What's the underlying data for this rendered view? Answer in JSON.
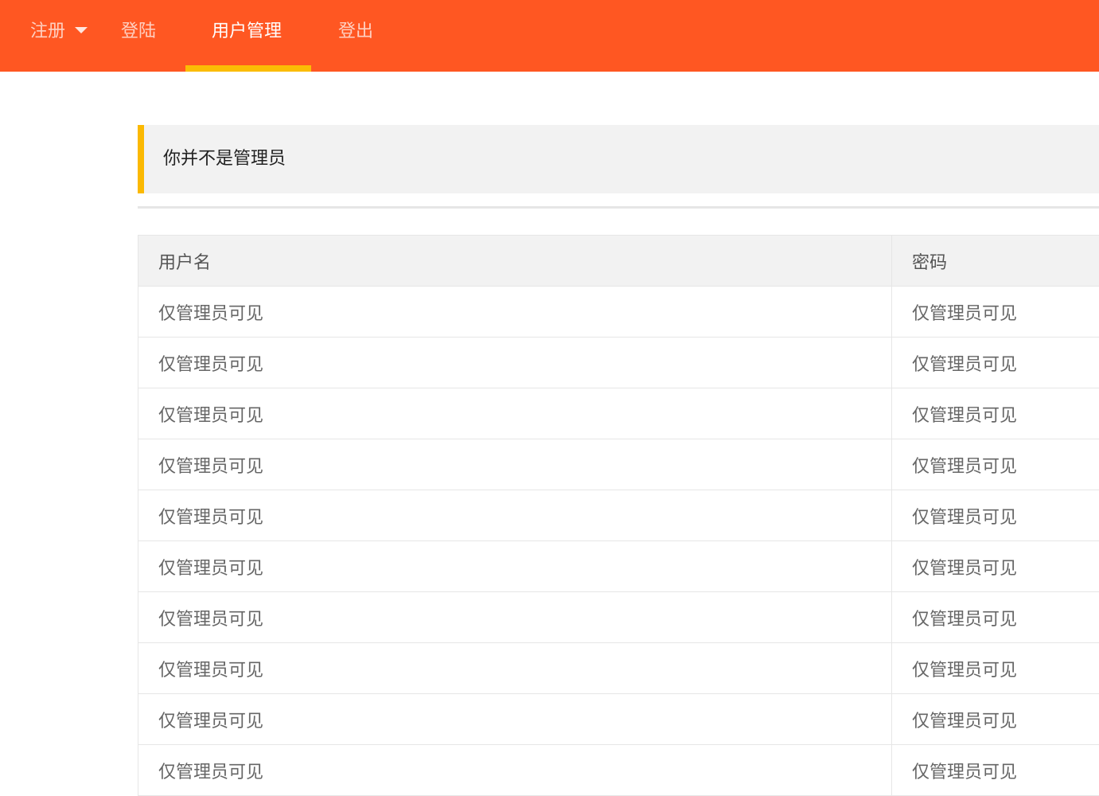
{
  "nav": {
    "items": [
      {
        "label": "注册",
        "has_dropdown": true,
        "active": false
      },
      {
        "label": "登陆",
        "active": false
      },
      {
        "label": "用户管理",
        "active": true
      },
      {
        "label": "登出",
        "active": false
      }
    ]
  },
  "notice": {
    "text": "你并不是管理员"
  },
  "table": {
    "columns": [
      "用户名",
      "密码"
    ],
    "rows": [
      [
        "仅管理员可见",
        "仅管理员可见"
      ],
      [
        "仅管理员可见",
        "仅管理员可见"
      ],
      [
        "仅管理员可见",
        "仅管理员可见"
      ],
      [
        "仅管理员可见",
        "仅管理员可见"
      ],
      [
        "仅管理员可见",
        "仅管理员可见"
      ],
      [
        "仅管理员可见",
        "仅管理员可见"
      ],
      [
        "仅管理员可见",
        "仅管理员可见"
      ],
      [
        "仅管理员可见",
        "仅管理员可见"
      ],
      [
        "仅管理员可见",
        "仅管理员可见"
      ],
      [
        "仅管理员可见",
        "仅管理员可见"
      ]
    ]
  },
  "colors": {
    "navbar": "#ff5722",
    "accent": "#fbbc05",
    "notice_bg": "#f2f2f2"
  }
}
